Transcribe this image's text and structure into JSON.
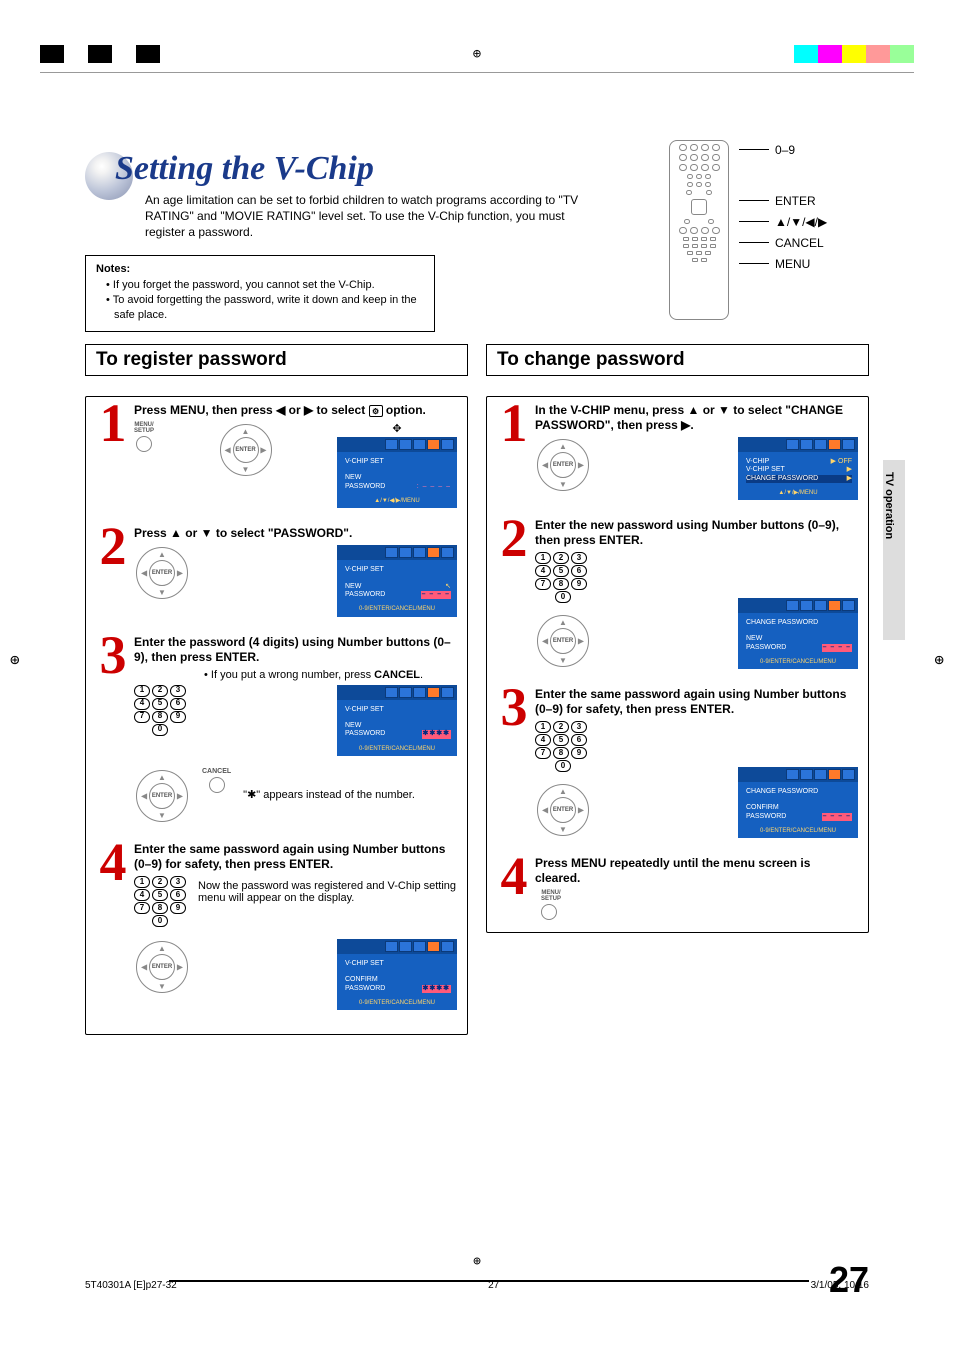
{
  "page_number": "27",
  "section_tab": "TV operation",
  "footer": {
    "left": "5T40301A [E]p27-32",
    "center": "27",
    "right": "3/1/05, 10:16"
  },
  "heading": "Setting the V-Chip",
  "intro": "An age limitation can be set to forbid children to watch programs according to \"TV RATING\" and \"MOVIE RATING\" level set. To use the V-Chip function, you must register a password.",
  "notes": {
    "title": "Notes:",
    "items": [
      "If you forget the password, you cannot set the V-Chip.",
      "To avoid forgetting the password, write it down and keep in the safe place."
    ]
  },
  "remote_labels": {
    "num": "0–9",
    "enter": "ENTER",
    "arrows": "▲/▼/◀/▶",
    "cancel": "CANCEL",
    "menu": "MENU"
  },
  "left_col": {
    "title": "To register password",
    "step1": {
      "head_pre": "Press MENU, then press ",
      "head_mid": " or ",
      "head_post": " to select ",
      "head_end": " option.",
      "btn_label": "MENU/\nSETUP",
      "osd": {
        "title": "V-CHIP  SET",
        "row1_l": "NEW",
        "row2_l": "PASSWORD",
        "dash": ": – – – –",
        "foot": "▲/▼/◀/▶/MENU"
      }
    },
    "step2": {
      "head_pre": "Press ",
      "head_mid": " or ",
      "head_post": " to select \"PASSWORD\".",
      "osd": {
        "title": "V-CHIP  SET",
        "row1_l": "NEW",
        "row2_l": "PASSWORD",
        "sel": "– – – –",
        "foot": "0-9/ENTER/CANCEL/MENU"
      }
    },
    "step3": {
      "head": "Enter the password (4 digits) using Number buttons (0–9), then press ENTER.",
      "sub1_pre": "• If you put a wrong number, press ",
      "sub1_bold": "CANCEL",
      "sub1_post": ".",
      "sub2": "\"✱\" appears instead of the number.",
      "cancel_label": "CANCEL",
      "osd": {
        "title": "V-CHIP  SET",
        "row1_l": "NEW",
        "row2_l": "PASSWORD",
        "sel": "✱✱✱✱",
        "foot": "0-9/ENTER/CANCEL/MENU"
      }
    },
    "step4": {
      "head": "Enter the same password again using Number buttons (0–9) for safety, then press ENTER.",
      "sub": "Now the password was registered and V-Chip setting menu will appear on the display.",
      "osd": {
        "title": "V-CHIP  SET",
        "row1_l": "CONFIRM",
        "row2_l": "PASSWORD",
        "sel": "✱✱✱✱",
        "foot": "0-9/ENTER/CANCEL/MENU"
      }
    }
  },
  "right_col": {
    "title": "To change password",
    "step1": {
      "head_pre": "In the V-CHIP menu, press ",
      "head_mid": " or ",
      "head_post": " to select \"CHANGE PASSWORD\", then press ",
      "head_end": ".",
      "osd": {
        "r1_l": "V-CHIP",
        "r1_r": "▶ OFF",
        "r2_l": "V-CHIP SET",
        "r2_r": "▶",
        "r3_l": "CHANGE PASSWORD",
        "r3_r": "▶",
        "foot": "▲/▼/▶/MENU"
      }
    },
    "step2": {
      "head": "Enter the new password using Number buttons (0–9), then press ENTER.",
      "osd": {
        "title": "CHANGE  PASSWORD",
        "row1_l": "NEW",
        "row2_l": "PASSWORD",
        "sel": "– – – –",
        "foot": "0-9/ENTER/CANCEL/MENU"
      }
    },
    "step3": {
      "head": "Enter the same password again using Number buttons (0–9) for safety, then press ENTER.",
      "osd": {
        "title": "CHANGE  PASSWORD",
        "row1_l": "CONFIRM",
        "row2_l": "PASSWORD",
        "sel": "– – – –",
        "foot": "0-9/ENTER/CANCEL/MENU"
      }
    },
    "step4": {
      "head": "Press MENU repeatedly until the menu screen is cleared.",
      "btn_label": "MENU/\nSETUP"
    }
  },
  "enter_text": "ENTER",
  "glyphs": {
    "left": "◀",
    "right": "▶",
    "up": "▲",
    "down": "▼",
    "opt_icon": "⚙"
  }
}
